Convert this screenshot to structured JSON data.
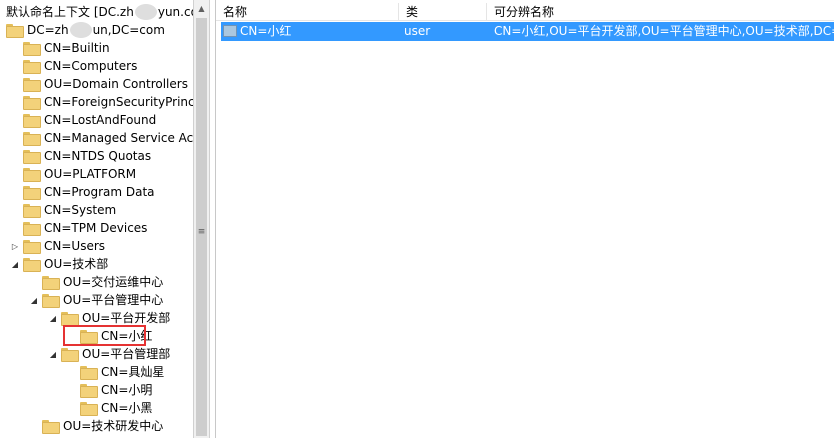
{
  "tree": {
    "root_label_prefix": "默认命名上下文 [DC.zh",
    "root_label_suffix": "yun.com",
    "domain_label_prefix": "DC=zh",
    "domain_label_suffix": "un,DC=com",
    "items": [
      {
        "label": "CN=Builtin",
        "depth": 1,
        "expander": ""
      },
      {
        "label": "CN=Computers",
        "depth": 1,
        "expander": ""
      },
      {
        "label": "OU=Domain Controllers",
        "depth": 1,
        "expander": ""
      },
      {
        "label": "CN=ForeignSecurityPrinci",
        "depth": 1,
        "expander": ""
      },
      {
        "label": "CN=LostAndFound",
        "depth": 1,
        "expander": ""
      },
      {
        "label": "CN=Managed Service Ac",
        "depth": 1,
        "expander": ""
      },
      {
        "label": "CN=NTDS Quotas",
        "depth": 1,
        "expander": ""
      },
      {
        "label": "OU=PLATFORM",
        "depth": 1,
        "expander": ""
      },
      {
        "label": "CN=Program Data",
        "depth": 1,
        "expander": ""
      },
      {
        "label": "CN=System",
        "depth": 1,
        "expander": ""
      },
      {
        "label": "CN=TPM Devices",
        "depth": 1,
        "expander": ""
      },
      {
        "label": "CN=Users",
        "depth": 1,
        "expander": "collapsed"
      },
      {
        "label": "OU=技术部",
        "depth": 1,
        "expander": "expanded"
      },
      {
        "label": "OU=交付运维中心",
        "depth": 2,
        "expander": ""
      },
      {
        "label": "OU=平台管理中心",
        "depth": 2,
        "expander": "expanded"
      },
      {
        "label": "OU=平台开发部",
        "depth": 3,
        "expander": "expanded"
      },
      {
        "label": "CN=小红",
        "depth": 4,
        "expander": "",
        "highlight": true
      },
      {
        "label": "OU=平台管理部",
        "depth": 3,
        "expander": "expanded"
      },
      {
        "label": "CN=具灿星",
        "depth": 4,
        "expander": ""
      },
      {
        "label": "CN=小明",
        "depth": 4,
        "expander": ""
      },
      {
        "label": "CN=小黑",
        "depth": 4,
        "expander": ""
      },
      {
        "label": "OU=技术研发中心",
        "depth": 2,
        "expander": ""
      }
    ]
  },
  "list": {
    "columns": [
      "名称",
      "类",
      "可分辨名称"
    ],
    "rows": [
      {
        "name": "CN=小红",
        "class": "user",
        "dn": "CN=小红,OU=平台开发部,OU=平台管理中心,OU=技术部,DC="
      }
    ],
    "selection_color": "#3399ff"
  },
  "highlight_color": "#e53232"
}
